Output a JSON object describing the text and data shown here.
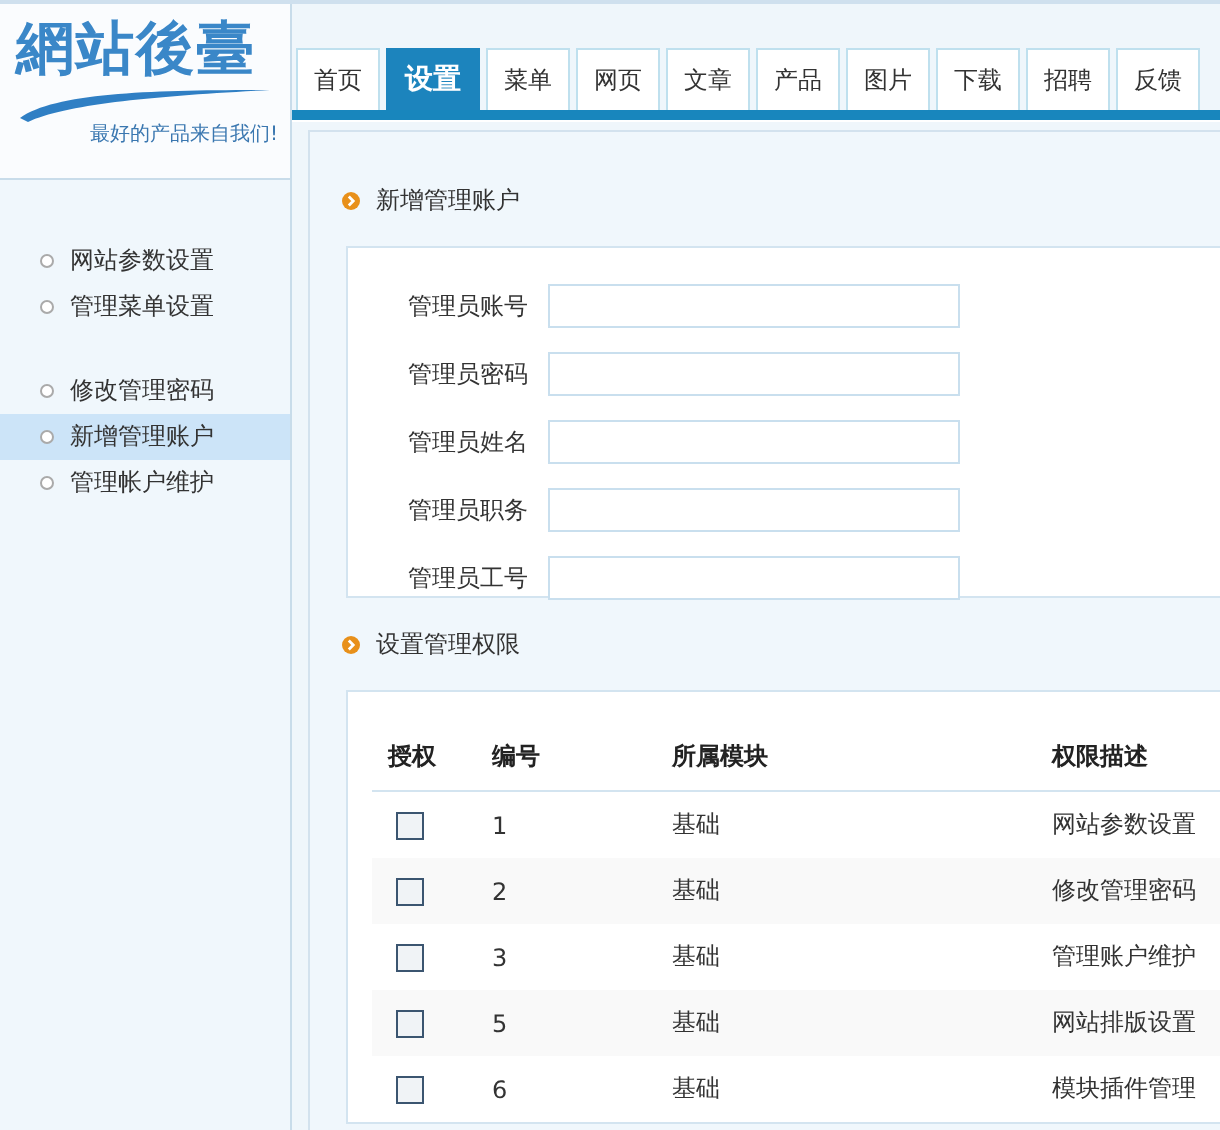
{
  "logo": {
    "title": "網站後臺",
    "slogan": "最好的产品来自我们!"
  },
  "tabs": [
    {
      "label": "首页",
      "selected": false
    },
    {
      "label": "设置",
      "selected": true
    },
    {
      "label": "菜单",
      "selected": false
    },
    {
      "label": "网页",
      "selected": false
    },
    {
      "label": "文章",
      "selected": false
    },
    {
      "label": "产品",
      "selected": false
    },
    {
      "label": "图片",
      "selected": false
    },
    {
      "label": "下载",
      "selected": false
    },
    {
      "label": "招聘",
      "selected": false
    },
    {
      "label": "反馈",
      "selected": false
    }
  ],
  "sidebar": {
    "groups": [
      [
        {
          "label": "网站参数设置",
          "selected": false
        },
        {
          "label": "管理菜单设置",
          "selected": false
        }
      ],
      [
        {
          "label": "修改管理密码",
          "selected": false
        },
        {
          "label": "新增管理账户",
          "selected": true
        },
        {
          "label": "管理帐户维护",
          "selected": false
        }
      ]
    ]
  },
  "account_section": {
    "title": "新增管理账户",
    "fields": [
      {
        "label": "管理员账号"
      },
      {
        "label": "管理员密码"
      },
      {
        "label": "管理员姓名"
      },
      {
        "label": "管理员职务"
      },
      {
        "label": "管理员工号"
      }
    ]
  },
  "permission_section": {
    "title": "设置管理权限",
    "columns": [
      "授权",
      "编号",
      "所属模块",
      "权限描述"
    ],
    "rows": [
      {
        "checked": false,
        "number": "1",
        "module": "基础",
        "description": "网站参数设置"
      },
      {
        "checked": false,
        "number": "2",
        "module": "基础",
        "description": "修改管理密码"
      },
      {
        "checked": false,
        "number": "3",
        "module": "基础",
        "description": "管理账户维护"
      },
      {
        "checked": false,
        "number": "5",
        "module": "基础",
        "description": "网站排版设置"
      },
      {
        "checked": false,
        "number": "6",
        "module": "基础",
        "description": "模块插件管理"
      }
    ]
  }
}
